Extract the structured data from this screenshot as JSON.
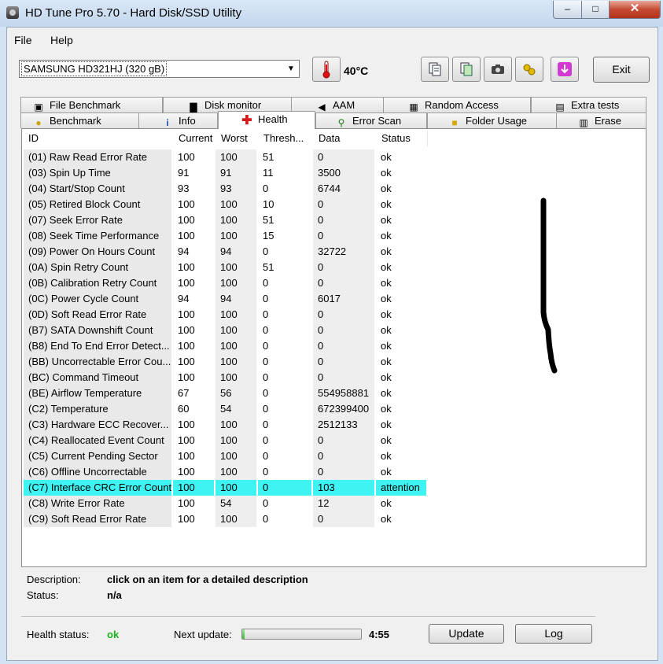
{
  "window": {
    "title": "HD Tune Pro 5.70 - Hard Disk/SSD Utility",
    "min": "–",
    "max": "□",
    "close": "✕"
  },
  "menu": {
    "file": "File",
    "help": "Help"
  },
  "toolbar": {
    "drive": "SAMSUNG HD321HJ (320 gB)",
    "temperature": "40°C",
    "exit": "Exit",
    "icons": [
      "copy-text-icon",
      "copy-screen-icon",
      "camera-icon",
      "options-icon",
      "save-icon"
    ]
  },
  "tabs_top": [
    {
      "label": "File Benchmark",
      "icon": "file-benchmark-icon"
    },
    {
      "label": "Disk monitor",
      "icon": "disk-monitor-icon"
    },
    {
      "label": "AAM",
      "icon": "speaker-icon"
    },
    {
      "label": "Random Access",
      "icon": "random-access-icon"
    },
    {
      "label": "Extra tests",
      "icon": "extra-tests-icon"
    }
  ],
  "tabs_bottom": [
    {
      "label": "Benchmark",
      "icon": "benchmark-icon"
    },
    {
      "label": "Info",
      "icon": "info-icon"
    },
    {
      "label": "Health",
      "icon": "health-cross-icon"
    },
    {
      "label": "Error Scan",
      "icon": "magnifier-icon"
    },
    {
      "label": "Folder Usage",
      "icon": "folder-icon"
    },
    {
      "label": "Erase",
      "icon": "trash-icon"
    }
  ],
  "table": {
    "headers": [
      "ID",
      "Current",
      "Worst",
      "Thresh...",
      "Data",
      "Status"
    ],
    "rows": [
      [
        "(01) Raw Read Error Rate",
        "100",
        "100",
        "51",
        "0",
        "ok"
      ],
      [
        "(03) Spin Up Time",
        "91",
        "91",
        "11",
        "3500",
        "ok"
      ],
      [
        "(04) Start/Stop Count",
        "93",
        "93",
        "0",
        "6744",
        "ok"
      ],
      [
        "(05) Retired Block Count",
        "100",
        "100",
        "10",
        "0",
        "ok"
      ],
      [
        "(07) Seek Error Rate",
        "100",
        "100",
        "51",
        "0",
        "ok"
      ],
      [
        "(08) Seek Time Performance",
        "100",
        "100",
        "15",
        "0",
        "ok"
      ],
      [
        "(09) Power On Hours Count",
        "94",
        "94",
        "0",
        "32722",
        "ok"
      ],
      [
        "(0A) Spin Retry Count",
        "100",
        "100",
        "51",
        "0",
        "ok"
      ],
      [
        "(0B) Calibration Retry Count",
        "100",
        "100",
        "0",
        "0",
        "ok"
      ],
      [
        "(0C) Power Cycle Count",
        "94",
        "94",
        "0",
        "6017",
        "ok"
      ],
      [
        "(0D) Soft Read Error Rate",
        "100",
        "100",
        "0",
        "0",
        "ok"
      ],
      [
        "(B7) SATA Downshift Count",
        "100",
        "100",
        "0",
        "0",
        "ok"
      ],
      [
        "(B8) End To End Error Detect...",
        "100",
        "100",
        "0",
        "0",
        "ok"
      ],
      [
        "(BB) Uncorrectable Error Cou...",
        "100",
        "100",
        "0",
        "0",
        "ok"
      ],
      [
        "(BC) Command Timeout",
        "100",
        "100",
        "0",
        "0",
        "ok"
      ],
      [
        "(BE) Airflow Temperature",
        "67",
        "56",
        "0",
        "554958881",
        "ok"
      ],
      [
        "(C2) Temperature",
        "60",
        "54",
        "0",
        "672399400",
        "ok"
      ],
      [
        "(C3) Hardware ECC Recover...",
        "100",
        "100",
        "0",
        "2512133",
        "ok"
      ],
      [
        "(C4) Reallocated Event Count",
        "100",
        "100",
        "0",
        "0",
        "ok"
      ],
      [
        "(C5) Current Pending Sector",
        "100",
        "100",
        "0",
        "0",
        "ok"
      ],
      [
        "(C6) Offline Uncorrectable",
        "100",
        "100",
        "0",
        "0",
        "ok"
      ],
      [
        "(C7) Interface CRC Error Count",
        "100",
        "100",
        "0",
        "103",
        "attention"
      ],
      [
        "(C8) Write Error Rate",
        "100",
        "54",
        "0",
        "12",
        "ok"
      ],
      [
        "(C9) Soft Read Error Rate",
        "100",
        "100",
        "0",
        "0",
        "ok"
      ]
    ],
    "highlight_row": 21,
    "highlight_color": "#3ff3f3"
  },
  "details": {
    "description_label": "Description:",
    "description_value": "click on an item for a detailed description",
    "status_label": "Status:",
    "status_value": "n/a"
  },
  "footer": {
    "health_label": "Health status:",
    "health_value": "ok",
    "health_color": "#1fb21f",
    "next_update_label": "Next update:",
    "next_update_progress": 0.02,
    "next_update_time": "4:55",
    "update_button": "Update",
    "log_button": "Log"
  }
}
